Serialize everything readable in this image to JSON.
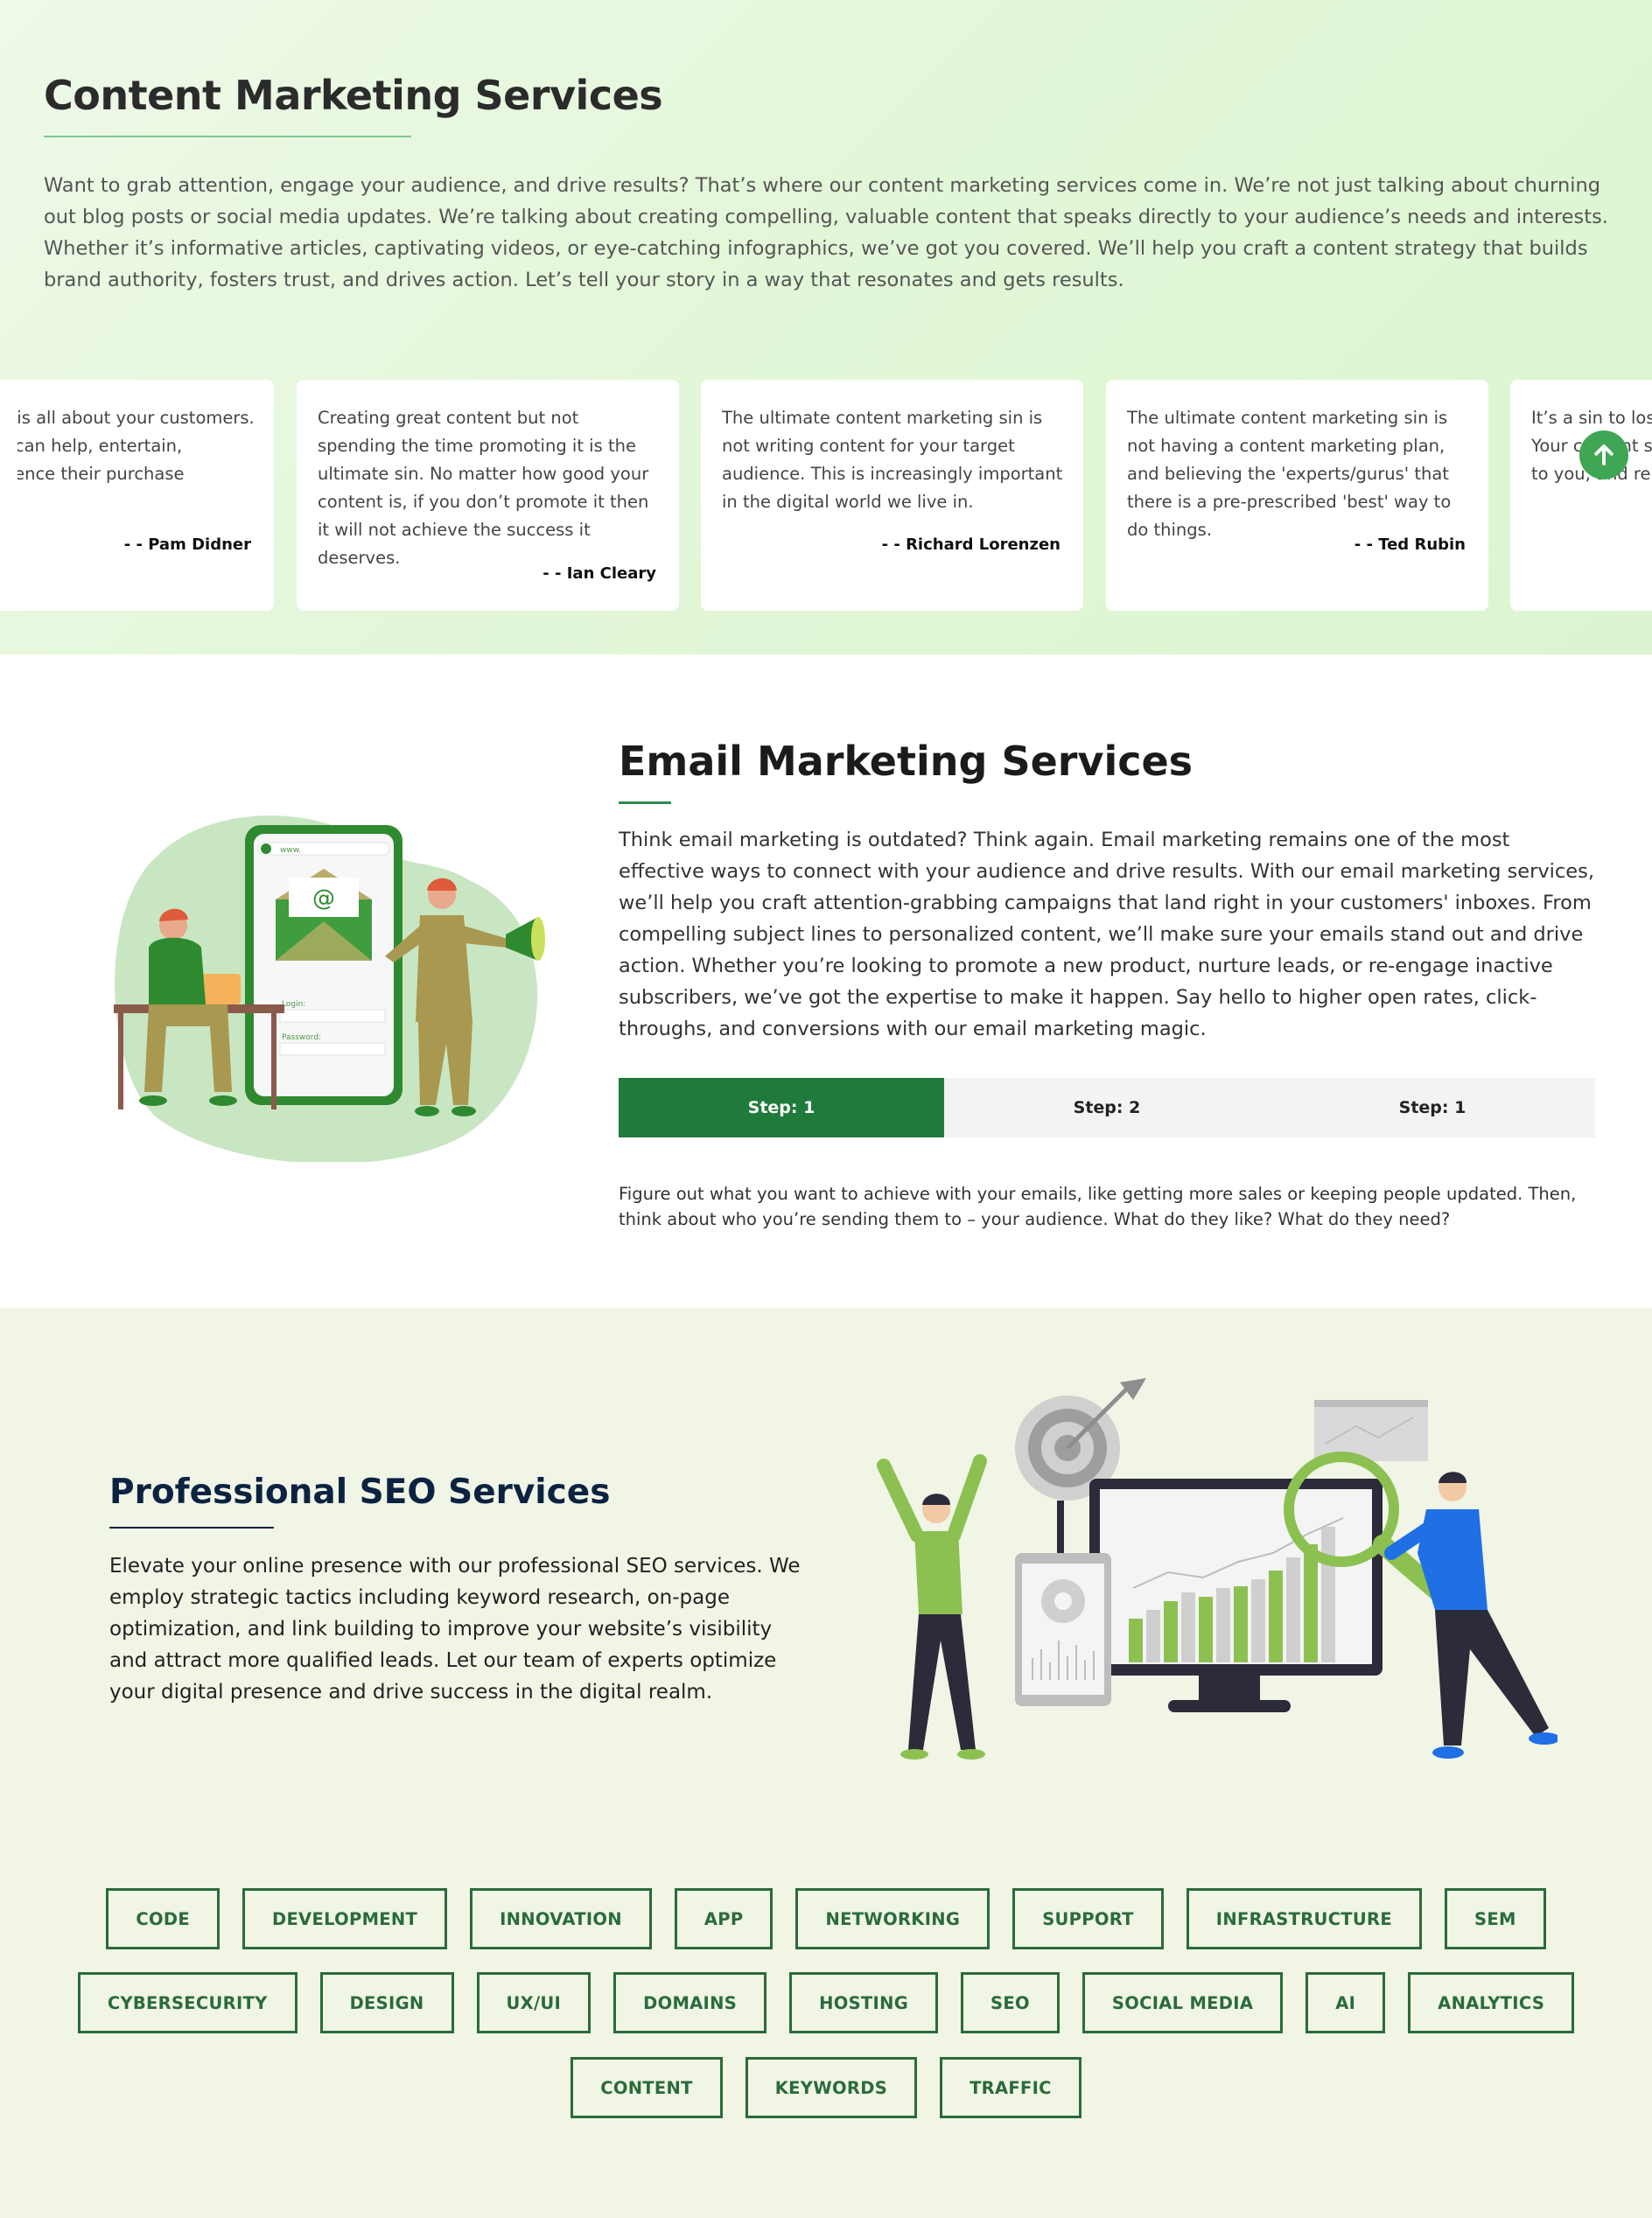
{
  "content_marketing": {
    "title": "Content Marketing Services",
    "body": "Want to grab attention, engage your audience, and drive results? That’s where our content marketing services come in. We’re not just talking about churning out blog posts or social media updates. We’re talking about creating compelling, valuable content that speaks directly to your audience’s needs and interests. Whether it’s informative articles, captivating videos, or eye-catching infographics, we’ve got you covered. We’ll help you craft a content strategy that builds brand authority, fosters trust, and drives action. Let’s tell your story in a way that resonates and gets results.",
    "testimonials": [
      {
        "quote": "Content marketing is all about your customers. It’s about how you can help, entertain, challenge and influence their purchase decisions.",
        "author": "- - Pam Didner"
      },
      {
        "quote": "Creating great content but not spending the time promoting it is the ultimate sin. No matter how good your content is, if you don’t promote it then it will not achieve the success it deserves.",
        "author": "- - Ian Cleary"
      },
      {
        "quote": "The ultimate content marketing sin is not writing content for your target audience. This is increasingly important in the digital world we live in.",
        "author": "- - Richard Lorenzen"
      },
      {
        "quote": "The ultimate content marketing sin is not having a content marketing plan, and believing the 'experts/gurus' that there is a pre-prescribed 'best' way to do things.",
        "author": "- - Ted Rubin"
      },
      {
        "quote": "It’s a sin to lose sight. Your content should speak to you, and relate",
        "author": ""
      }
    ]
  },
  "email_marketing": {
    "title": "Email Marketing Services",
    "body": "Think email marketing is outdated? Think again. Email marketing remains one of the most effective ways to connect with your audience and drive results. With our email marketing services, we’ll help you craft attention-grabbing campaigns that land right in your customers' inboxes. From compelling subject lines to personalized content, we’ll make sure your emails stand out and drive action. Whether you’re looking to promote a new product, nurture leads, or re-engage inactive subscribers, we’ve got the expertise to make it happen. Say hello to higher open rates, click-throughs, and conversions with our email marketing magic.",
    "steps": [
      "Step: 1",
      "Step: 2",
      "Step: 1"
    ],
    "active_step": 0,
    "step_description": "Figure out what you want to achieve with your emails, like getting more sales or keeping people updated. Then, think about who you’re sending them to – your audience. What do they like? What do they need?",
    "illustration": {
      "url_label": "www.",
      "login_label": "Login:",
      "password_label": "Password:",
      "at_symbol": "@"
    }
  },
  "seo": {
    "title": "Professional SEO Services",
    "body": "Elevate your online presence with our professional SEO services. We employ strategic tactics including keyword research, on-page optimization, and link building to improve your website’s visibility and attract more qualified leads. Let our team of experts optimize your digital presence and drive success in the digital realm."
  },
  "tags": {
    "row1": [
      "CODE",
      "DEVELOPMENT",
      "INNOVATION",
      "APP",
      "NETWORKING",
      "SUPPORT",
      "INFRASTRUCTURE",
      "SEM"
    ],
    "row2": [
      "CYBERSECURITY",
      "DESIGN",
      "UX/UI",
      "DOMAINS",
      "HOSTING",
      "SEO",
      "SOCIAL MEDIA",
      "AI",
      "ANALYTICS"
    ],
    "row3": [
      "CONTENT",
      "KEYWORDS",
      "TRAFFIC"
    ]
  },
  "colors": {
    "accent": "#1f7a3b",
    "tag_border": "#2a6b3a",
    "scroll_button": "#3fa654",
    "seo_title": "#0b2341"
  },
  "icons": {
    "scroll_top": "arrow-up-icon"
  }
}
